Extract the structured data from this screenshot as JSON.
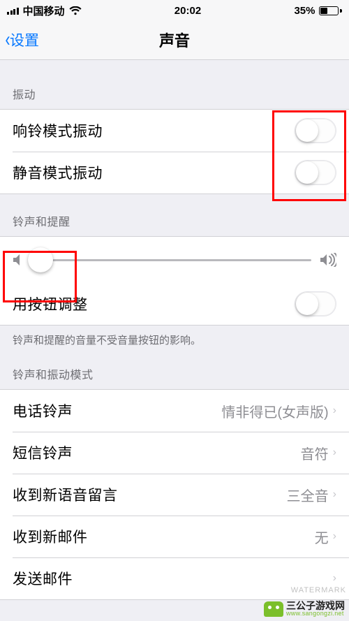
{
  "statusbar": {
    "carrier": "中国移动",
    "time": "20:02",
    "battery_pct": "35%"
  },
  "nav": {
    "back_label": "设置",
    "title": "声音"
  },
  "sections": {
    "vibration_header": "振动",
    "ringer_header": "铃声和提醒",
    "ringer_footer": "铃声和提醒的音量不受音量按钮的影响。",
    "mode_header": "铃声和振动模式"
  },
  "rows": {
    "vibrate_ring": "响铃模式振动",
    "vibrate_silent": "静音模式振动",
    "button_adjust": "用按钮调整",
    "ringtone": {
      "label": "电话铃声",
      "value": "情非得已(女声版)"
    },
    "sms": {
      "label": "短信铃声",
      "value": "音符"
    },
    "voicemail": {
      "label": "收到新语音留言",
      "value": "三全音"
    },
    "mail": {
      "label": "收到新邮件",
      "value": "无"
    },
    "sent_mail": {
      "label": "发送邮件",
      "value": ""
    }
  },
  "slider": {
    "value_pct": 3
  },
  "watermark": "WATERMARK",
  "brand": {
    "name": "三公子游戏网",
    "url": "www.sangongzi.net"
  }
}
